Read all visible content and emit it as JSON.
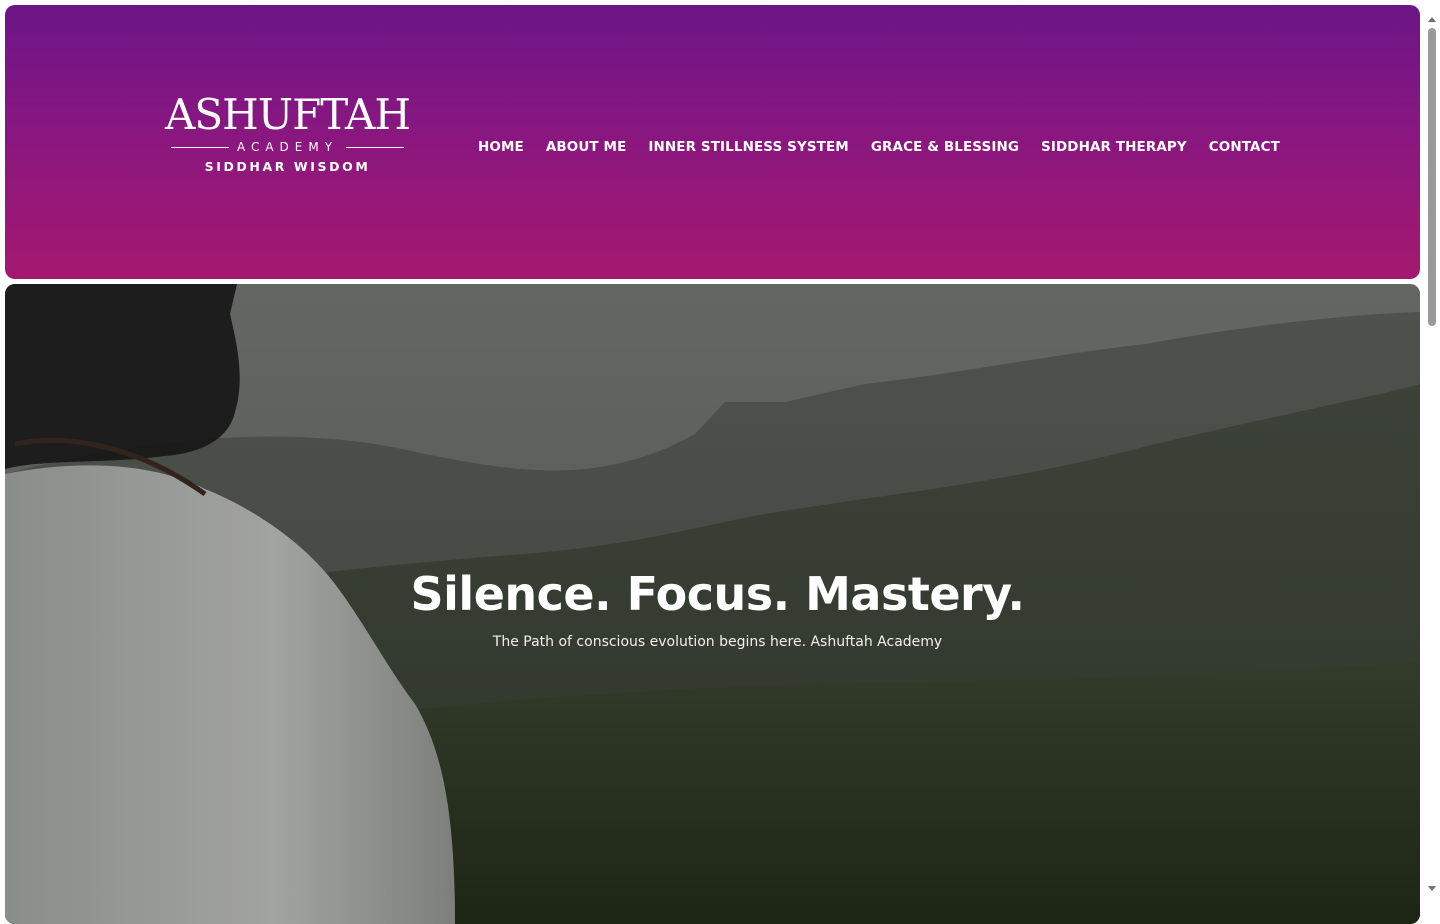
{
  "brand": {
    "name": "ASHUFTAH",
    "subtitle": "ACADEMY",
    "tagline": "SIDDHAR WISDOM"
  },
  "nav": {
    "items": [
      {
        "label": "HOME"
      },
      {
        "label": "ABOUT ME"
      },
      {
        "label": "INNER STILLNESS SYSTEM"
      },
      {
        "label": "GRACE & BLESSING"
      },
      {
        "label": "SIDDHAR THERAPY"
      },
      {
        "label": "CONTACT"
      }
    ]
  },
  "hero": {
    "title": "Silence. Focus. Mastery.",
    "subtitle": "The Path of conscious evolution begins here. Ashuftah Academy",
    "image": "man-overlooking-misty-mountains"
  },
  "colors": {
    "header_top": "#6c1587",
    "header_bottom": "#a4196f",
    "text": "#ffffff"
  }
}
